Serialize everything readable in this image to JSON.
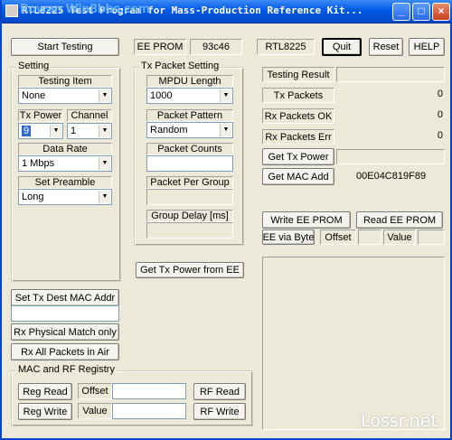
{
  "window": {
    "title": "RTL8225 Test Program for Mass-Production Reference Kit...",
    "watermark": "Rowan Win8bbs.com",
    "controls": [
      "_",
      "□",
      "×"
    ]
  },
  "toolbar": {
    "start_testing": "Start Testing",
    "ee_prom_label": "EE PROM",
    "ee_prom_value": "93c46",
    "chip_label": "RTL8225",
    "quit": "Quit",
    "reset": "Reset",
    "help": "HELP"
  },
  "setting": {
    "group_title": "Setting",
    "testing_item_label": "Testing Item",
    "testing_item_value": "None",
    "tx_power_label": "Tx Power",
    "tx_power_value": "9",
    "channel_label": "Channel",
    "channel_value": "1",
    "data_rate_label": "Data Rate",
    "data_rate_value": "1 Mbps",
    "preamble_label": "Set Preamble",
    "preamble_value": "Long"
  },
  "tx_packet": {
    "group_title": "Tx Packet Setting",
    "mpdu_label": "MPDU Length",
    "mpdu_value": "1000",
    "pattern_label": "Packet Pattern",
    "pattern_value": "Random",
    "counts_label": "Packet Counts",
    "counts_value": "",
    "per_group_label": "Packet Per Group",
    "group_delay_label": "Group Delay [ms]"
  },
  "results": {
    "testing_result_label": "Testing Result",
    "testing_result_value": "",
    "tx_packets_label": "Tx Packets",
    "tx_packets_value": "0",
    "rx_ok_label": "Rx Packets OK",
    "rx_ok_value": "0",
    "rx_err_label": "Rx Packets Err",
    "rx_err_value": "0",
    "get_tx_power": "Get Tx Power",
    "get_tx_power_value": "",
    "get_mac_add": "Get MAC Add",
    "mac_value": "00E04C819F89"
  },
  "eeprom": {
    "write": "Write EE PROM",
    "read": "Read EE PROM",
    "via_byte": "EE via Byte",
    "offset_label": "Offset",
    "value_label": "Value"
  },
  "get_tx_power_from_ee": "Get Tx Power from EE",
  "left_actions": {
    "set_dest_mac": "Set Tx Dest MAC Addr",
    "rx_physical": "Rx Physical Match only",
    "rx_all": "Rx All Packets in Air"
  },
  "mac_rf": {
    "group_title": "MAC and RF Registry",
    "reg_read": "Reg Read",
    "reg_write": "Reg Write",
    "offset_label": "Offset",
    "value_label": "Value",
    "rf_read": "RF Read",
    "rf_write": "RF Write"
  },
  "brand_watermark": "Lossr.net"
}
